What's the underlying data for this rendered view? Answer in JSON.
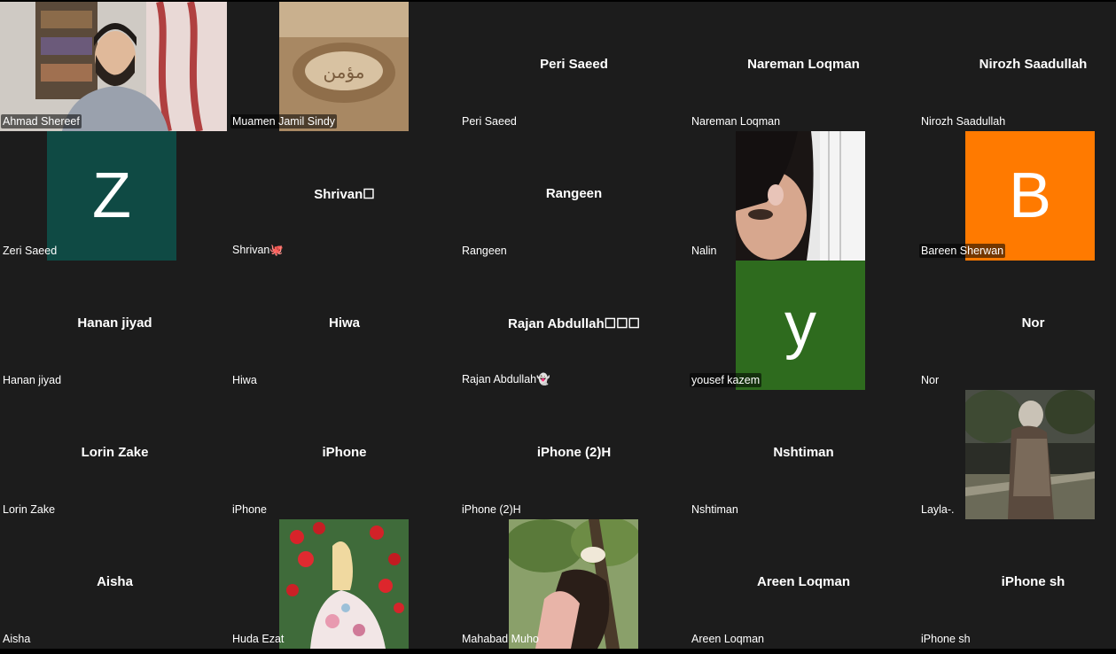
{
  "meeting": {
    "participants": [
      {
        "name": "Ahmad Shereef",
        "display": "video",
        "label": "Ahmad Shereef"
      },
      {
        "name": "Muamen Jamil Sindy",
        "display": "photo",
        "label": "Muamen Jamil Sindy"
      },
      {
        "name": "Peri Saeed",
        "display": "name",
        "label": "Peri Saeed"
      },
      {
        "name": "Nareman Loqman",
        "display": "name",
        "label": "Nareman Loqman"
      },
      {
        "name": "Nirozh Saadullah",
        "display": "name",
        "label": "Nirozh Saadullah"
      },
      {
        "name": "Zeri Saeed",
        "display": "avatar",
        "letter": "Z",
        "color": "#0f4a44",
        "label": "Zeri Saeed"
      },
      {
        "name": "Shrivan☐",
        "display": "name",
        "label": "Shrivan🐙"
      },
      {
        "name": "Rangeen",
        "display": "name",
        "label": "Rangeen"
      },
      {
        "name": "Nalin",
        "display": "photo",
        "label": "Nalin"
      },
      {
        "name": "Bareen Sherwan",
        "display": "avatar",
        "letter": "B",
        "color": "#ff7a00",
        "label": "Bareen Sherwan"
      },
      {
        "name": "Hanan jiyad",
        "display": "name",
        "label": "Hanan jiyad"
      },
      {
        "name": "Hiwa",
        "display": "name",
        "label": "Hiwa"
      },
      {
        "name": "Rajan  Abdullah☐☐☐",
        "display": "name",
        "label": "Rajan Abdullah👻"
      },
      {
        "name": "yousef kazem",
        "display": "avatar",
        "letter": "y",
        "color": "#2e6b1e",
        "label": "yousef kazem"
      },
      {
        "name": "Nor",
        "display": "name",
        "label": "Nor"
      },
      {
        "name": "Lorin Zake",
        "display": "name",
        "label": "Lorin Zake"
      },
      {
        "name": "iPhone",
        "display": "name",
        "label": "iPhone"
      },
      {
        "name": "iPhone (2)H",
        "display": "name",
        "label": "iPhone (2)H"
      },
      {
        "name": "Nshtiman",
        "display": "name",
        "label": "Nshtiman"
      },
      {
        "name": "Layla-.",
        "display": "photo",
        "label": "Layla-."
      },
      {
        "name": "Aisha",
        "display": "name",
        "label": "Aisha"
      },
      {
        "name": "Huda Ezat",
        "display": "photo",
        "label": "Huda Ezat"
      },
      {
        "name": "Mahabad Muho",
        "display": "photo",
        "label": "Mahabad Muho"
      },
      {
        "name": "Areen Loqman",
        "display": "name",
        "label": "Areen Loqman"
      },
      {
        "name": "iPhone sh",
        "display": "name",
        "label": "iPhone sh"
      }
    ]
  }
}
